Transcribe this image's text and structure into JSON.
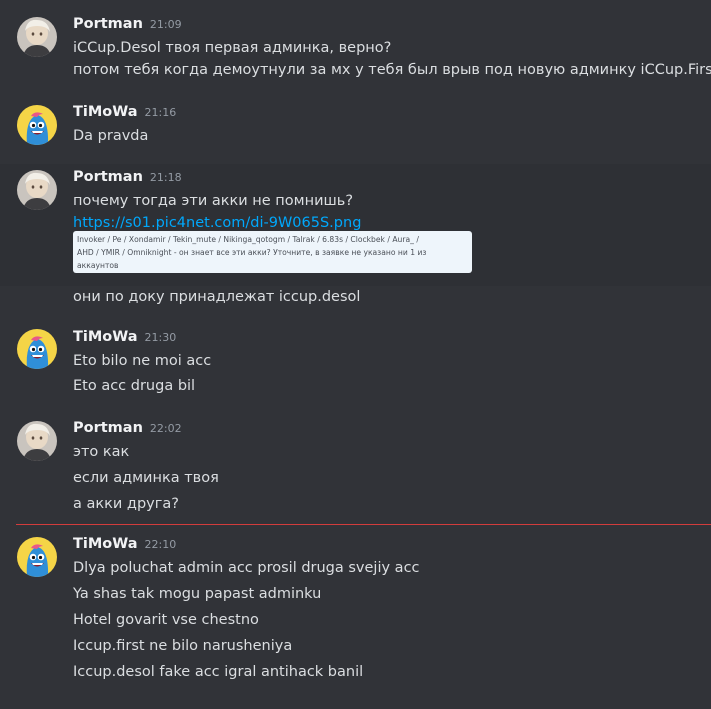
{
  "messages": [
    {
      "author": "Portman",
      "time": "21:09",
      "lines": [
        "iCCup.Desol твоя первая админка, верно?",
        "потом тебя когда демоутнули за мх у тебя был врыв под новую админку iCCup.First?"
      ]
    },
    {
      "author": "TiMoWa",
      "time": "21:16",
      "lines": [
        "Da pravda"
      ]
    },
    {
      "author": "Portman",
      "time": "21:18",
      "lines": [
        "почему тогда эти акки не помнишь?"
      ],
      "link": "https://s01.pic4net.com/di-9W065S.png",
      "embed_text": "Invoker / Pe / Xondamir / Tekin_mute / Nikinga_qotogm / Talrak / 6.83s / Clockbek / Aura_ /\nAHD / YMIR / Omniknight - он знает все эти акки? Уточните, в заявке не указано ни 1 из\nаккаунтов",
      "after_lines": [
        "они по доку принадлежат iccup.desol"
      ]
    },
    {
      "author": "TiMoWa",
      "time": "21:30",
      "lines": [
        "Eto bilo ne moi acc",
        "Eto acc druga bil"
      ]
    },
    {
      "author": "Portman",
      "time": "22:02",
      "lines": [
        "это как",
        "если админка твоя",
        "а акки друга?"
      ]
    },
    {
      "author": "TiMoWa",
      "time": "22:10",
      "lines": [
        "Dlya poluchat admin acc prosil druga svejiy acc",
        "Ya shas tak mogu papast adminku",
        "Hotel govarit vse chestno",
        "Iccup.first ne bilo narusheniya",
        "Iccup.desol fake acc igral antihack banil"
      ]
    }
  ],
  "colors": {
    "background": "#313338",
    "highlight": "#2e3035",
    "link": "#00a8fc",
    "new_divider": "#d23c3c"
  },
  "icons": {
    "portman_avatar": "woman-photo-avatar",
    "timowa_avatar": "blue-cartoon-creature-avatar"
  }
}
